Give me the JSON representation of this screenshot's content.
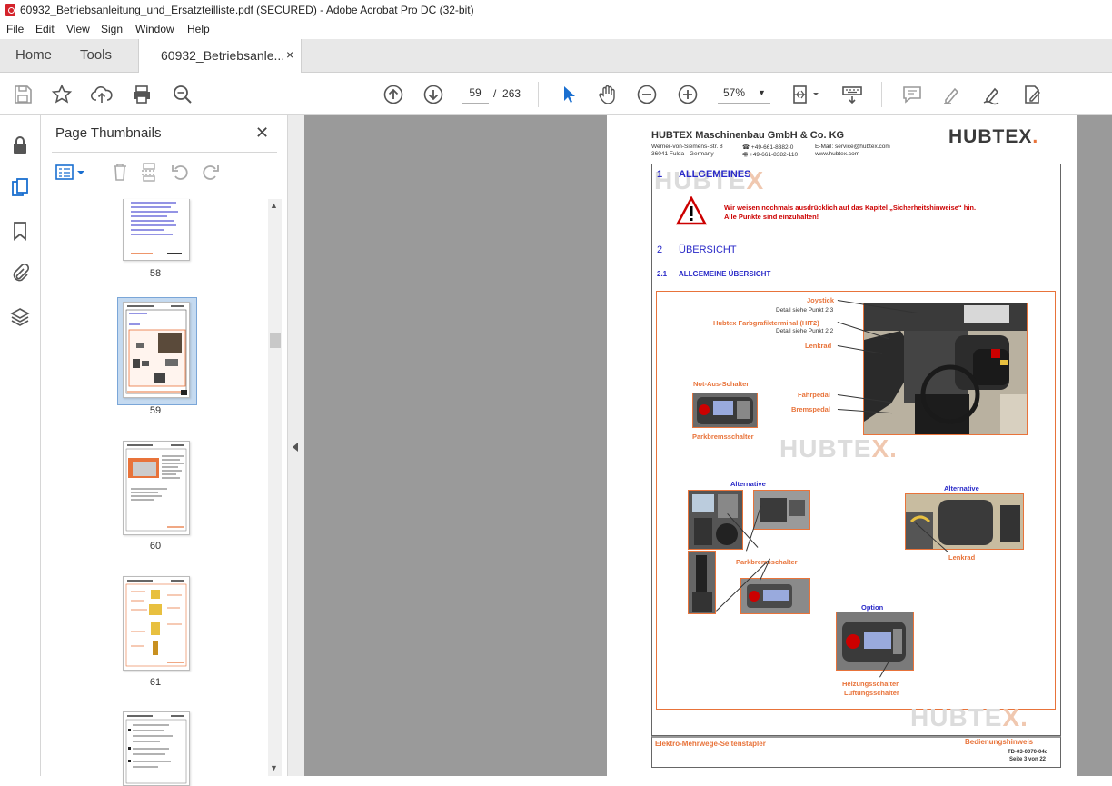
{
  "window": {
    "title": "60932_Betriebsanleitung_und_Ersatzteilliste.pdf (SECURED) - Adobe Acrobat Pro DC (32-bit)"
  },
  "menu": [
    "File",
    "Edit",
    "View",
    "Sign",
    "Window",
    "Help"
  ],
  "tabs": {
    "home": "Home",
    "tools": "Tools",
    "document": "60932_Betriebsanle...",
    "close": "×"
  },
  "toolbar": {
    "current_page": "59",
    "page_separator": "/",
    "total_pages": "263",
    "zoom": "57%"
  },
  "thumbnails_panel": {
    "title": "Page Thumbnails",
    "close": "✕",
    "pages": [
      {
        "num": "58",
        "selected": false
      },
      {
        "num": "59",
        "selected": true
      },
      {
        "num": "60",
        "selected": false
      },
      {
        "num": "61",
        "selected": false
      },
      {
        "num": "",
        "selected": false
      }
    ]
  },
  "pdf_page": {
    "company": "HUBTEX Maschinenbau GmbH & Co. KG",
    "address_line1": "Werner-von-Siemens-Str. 8",
    "address_line2": "36041 Fulda - Germany",
    "phone": "☎ +49-661-8382-0",
    "fax": "🖷 +49-661-8382-110",
    "email": "E-Mail: service@hubtex.com",
    "web": "www.hubtex.com",
    "logo": "HUBTEX",
    "section1_num": "1",
    "section1_title": "ALLGEMEINES",
    "warning_line1": "Wir weisen nochmals ausdrücklich auf das Kapitel „Sicherheitshinweise“ hin.",
    "warning_line2": "Alle Punkte sind einzuhalten!",
    "section2_num": "2",
    "section2_title": "ÜBERSICHT",
    "section21_num": "2.1",
    "section21_title": "ALLGEMEINE ÜBERSICHT",
    "labels": {
      "joystick": "Joystick",
      "joystick_detail": "Detail siehe Punkt 2.3",
      "terminal": "Hubtex Farbgrafikterminal (HIT2)",
      "terminal_detail": "Detail siehe Punkt 2.2",
      "lenkrad": "Lenkrad",
      "not_aus": "Not-Aus-Schalter",
      "fahrpedal": "Fahrpedal",
      "bremspedal": "Bremspedal",
      "parkbrems1": "Parkbremsschalter",
      "alternative1": "Alternative",
      "alternative2": "Alternative",
      "parkbrems2": "Parkbremsschalter",
      "lenkrad2": "Lenkrad",
      "option": "Option",
      "heizung": "Heizungsschalter",
      "lueftung": "Lüftungsschalter"
    },
    "footer_left": "Elektro-Mehrwege-Seitenstapler",
    "footer_right": "Bedienungshinweis",
    "footer_code": "TD-03-0070-04d",
    "footer_page": "Seite 3 von 22"
  }
}
